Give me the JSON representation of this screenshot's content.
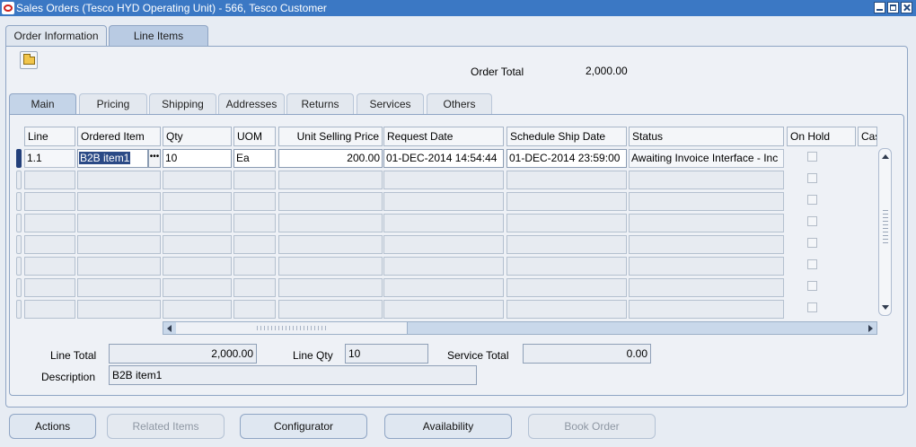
{
  "window": {
    "title": "Sales Orders (Tesco HYD Operating Unit) - 566, Tesco Customer"
  },
  "top_tabs": [
    {
      "label": "Order Information",
      "active": false
    },
    {
      "label": "Line Items",
      "active": true
    }
  ],
  "order_total": {
    "label": "Order Total",
    "value": "2,000.00"
  },
  "sub_tabs": [
    {
      "label": "Main",
      "active": true
    },
    {
      "label": "Pricing",
      "active": false
    },
    {
      "label": "Shipping",
      "active": false
    },
    {
      "label": "Addresses",
      "active": false
    },
    {
      "label": "Returns",
      "active": false
    },
    {
      "label": "Services",
      "active": false
    },
    {
      "label": "Others",
      "active": false
    }
  ],
  "grid": {
    "columns": [
      "Line",
      "Ordered Item",
      "Qty",
      "UOM",
      "Unit Selling Price",
      "Request Date",
      "Schedule Ship Date",
      "Status",
      "On Hold",
      "Cas"
    ],
    "rows": [
      {
        "line": "1.1",
        "ordered_item": "B2B item1",
        "qty": "10",
        "uom": "Ea",
        "unit_selling_price": "200.00",
        "request_date": "01-DEC-2014 14:54:44",
        "schedule_ship_date": "01-DEC-2014 23:59:00",
        "status": "Awaiting Invoice Interface - Inc",
        "on_hold": false
      }
    ],
    "empty_rows": 7
  },
  "summary": {
    "line_total_label": "Line Total",
    "line_total_value": "2,000.00",
    "line_qty_label": "Line Qty",
    "line_qty_value": "10",
    "service_total_label": "Service Total",
    "service_total_value": "0.00",
    "description_label": "Description",
    "description_value": "B2B item1"
  },
  "buttons": {
    "actions": {
      "label": "Actions",
      "enabled": true
    },
    "related_items": {
      "label": "Related Items",
      "enabled": false
    },
    "configurator": {
      "label": "Configurator",
      "enabled": true
    },
    "availability": {
      "label": "Availability",
      "enabled": true
    },
    "book_order": {
      "label": "Book Order",
      "enabled": false
    }
  },
  "colors": {
    "title_bar": "#3b78c4",
    "selection": "#2b4a86",
    "panel": "#eef1f6"
  }
}
